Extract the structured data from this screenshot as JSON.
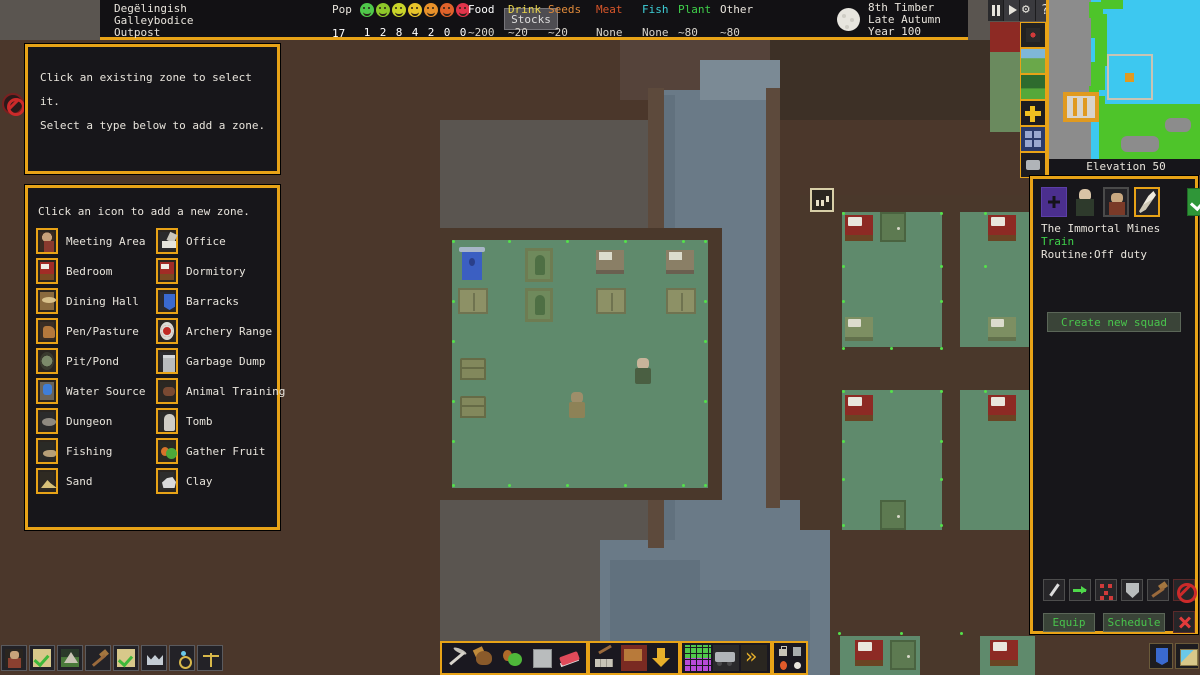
{
  "header": {
    "site_name_line1": "Degëlingish",
    "site_name_line2": "Galleybodice",
    "site_type": "Outpost",
    "pop_label": "Pop",
    "pop_value": "17",
    "mood_counts": [
      "1",
      "2",
      "8",
      "4",
      "2",
      "0",
      "0"
    ],
    "mood_colors": [
      "#4fc84a",
      "#8ec82a",
      "#c8d42a",
      "#e8c42a",
      "#e8912a",
      "#e0622a",
      "#e0344a"
    ],
    "stocks_button": "Stocks",
    "resources": [
      {
        "label": "Food",
        "value": "~200",
        "color": "#ffffff"
      },
      {
        "label": "Drink",
        "value": "~20",
        "color": "#e8d44a"
      },
      {
        "label": "Seeds",
        "value": "~20",
        "color": "#e08a3a"
      },
      {
        "label": "Meat",
        "value": "None",
        "color": "#d8562a"
      },
      {
        "label": "Fish",
        "value": "None",
        "color": "#3ed0d8"
      },
      {
        "label": "Plant",
        "value": "~80",
        "color": "#3fd04a"
      },
      {
        "label": "Other",
        "value": "~80",
        "color": "#e8e4dc"
      }
    ],
    "date_day": "8th Timber",
    "date_season": "Late Autumn",
    "date_year": "Year 100"
  },
  "time_controls": [
    {
      "name": "pause",
      "label": "Pause"
    },
    {
      "name": "play",
      "label": "Play"
    },
    {
      "name": "settings",
      "label": "Settings"
    },
    {
      "name": "help",
      "label": "Help"
    }
  ],
  "zone_help": {
    "line1": "Click an existing zone to select it.",
    "line2": "Select a type below to add a zone."
  },
  "zone_list": {
    "header": "Click an icon to add a new zone.",
    "items": [
      {
        "label": "Meeting Area",
        "icon": "meeting-icon"
      },
      {
        "label": "Office",
        "icon": "office-icon"
      },
      {
        "label": "Bedroom",
        "icon": "bedroom-icon"
      },
      {
        "label": "Dormitory",
        "icon": "dormitory-icon"
      },
      {
        "label": "Dining Hall",
        "icon": "dining-icon"
      },
      {
        "label": "Barracks",
        "icon": "barracks-icon"
      },
      {
        "label": "Pen/Pasture",
        "icon": "pen-icon"
      },
      {
        "label": "Archery Range",
        "icon": "archery-icon"
      },
      {
        "label": "Pit/Pond",
        "icon": "pit-icon"
      },
      {
        "label": "Garbage Dump",
        "icon": "garbage-icon"
      },
      {
        "label": "Water Source",
        "icon": "water-icon"
      },
      {
        "label": "Animal Training",
        "icon": "animal-icon"
      },
      {
        "label": "Dungeon",
        "icon": "dungeon-icon"
      },
      {
        "label": "Tomb",
        "icon": "tomb-icon"
      },
      {
        "label": "Fishing",
        "icon": "fishing-icon"
      },
      {
        "label": "Gather Fruit",
        "icon": "fruit-icon"
      },
      {
        "label": "Sand",
        "icon": "sand-icon"
      },
      {
        "label": "Clay",
        "icon": "clay-icon"
      }
    ]
  },
  "squad_panel": {
    "squad_name": "The Immortal Mines",
    "order": "Train",
    "routine": "Routine:Off duty",
    "create_button": "Create new squad",
    "equip_button": "Equip",
    "schedule_button": "Schedule",
    "tools": [
      "sword-icon",
      "move-arrow-icon",
      "formation-icon",
      "shield-icon",
      "hammer-icon",
      "no-orders-icon"
    ]
  },
  "minimap": {
    "elevation_label": "Elevation 50"
  },
  "bottom_left_toolbar": [
    "citizens-icon",
    "tasks-icon",
    "buildings-icon",
    "labor-icon",
    "work-orders-icon",
    "nobles-icon",
    "artifacts-icon",
    "justice-icon"
  ],
  "bottom_center_toolbar": {
    "group1": [
      "mine-icon",
      "chop-tree-icon",
      "gather-plants-icon",
      "smooth-stone-icon",
      "erase-designation-icon"
    ],
    "group2": [
      "construct-icon",
      "workshop-icon",
      "stockpile-down-icon"
    ],
    "group3": [
      "zones-icon",
      "vehicles-icon",
      "more-icon"
    ],
    "group4": [
      "lock-icon",
      "trash-icon",
      "fire-icon",
      "dot-icon"
    ]
  },
  "bottom_right_toolbar": [
    "civilizations-icon",
    "world-map-icon"
  ]
}
